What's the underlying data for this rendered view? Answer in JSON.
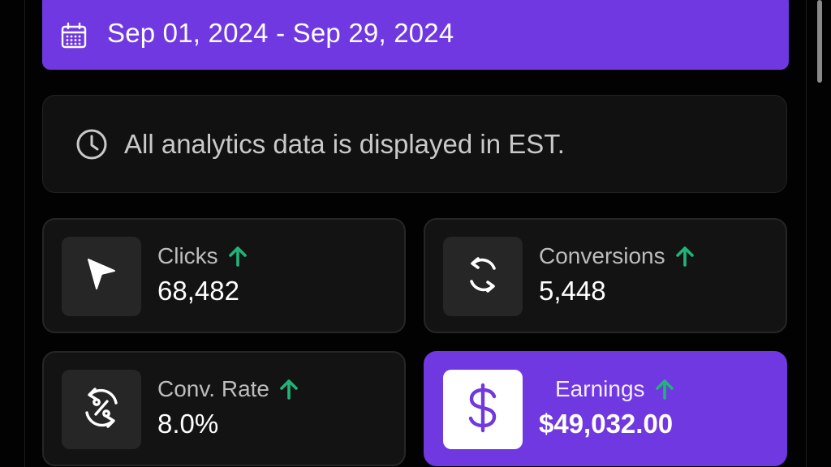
{
  "date_range": {
    "label": "Sep 01, 2024 - Sep 29, 2024",
    "icon": "calendar-icon"
  },
  "timezone_notice": {
    "text": "All analytics data is displayed in EST.",
    "icon": "clock-icon"
  },
  "stats": [
    {
      "label": "Clicks",
      "value": "68,482",
      "icon": "cursor-pointer-icon",
      "trend": "up"
    },
    {
      "label": "Conversions",
      "value": "5,448",
      "icon": "refresh-cycle-icon",
      "trend": "up"
    },
    {
      "label": "Conv. Rate",
      "value": "8.0%",
      "icon": "percent-cycle-icon",
      "trend": "up"
    },
    {
      "label": "Earnings",
      "value": "$49,032.00",
      "icon": "dollar-icon",
      "trend": "up"
    }
  ],
  "colors": {
    "accent": "#7038e0",
    "trend_up": "#21b47a",
    "card_bg": "#131313",
    "page_bg": "#020202"
  }
}
